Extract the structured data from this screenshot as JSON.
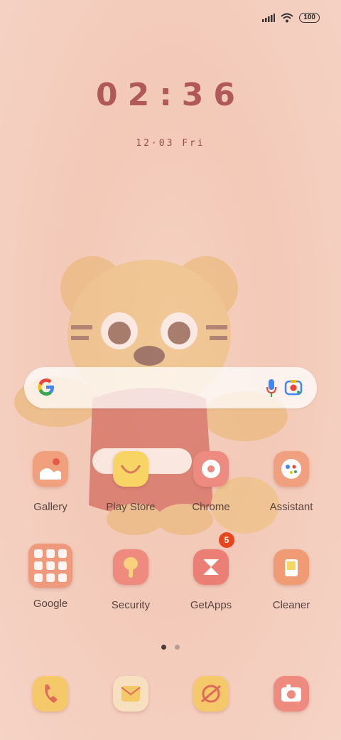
{
  "status": {
    "battery": "100"
  },
  "lockscreen": {
    "time": "02:36",
    "date": "12·03  Fri"
  },
  "apps_row1": [
    {
      "label": "Gallery"
    },
    {
      "label": "Play Store"
    },
    {
      "label": "Chrome"
    },
    {
      "label": "Assistant"
    }
  ],
  "apps_row2": [
    {
      "label": "Google"
    },
    {
      "label": "Security"
    },
    {
      "label": "GetApps",
      "badge": "5"
    },
    {
      "label": "Cleaner"
    }
  ],
  "page_indicator": {
    "pages": 2,
    "current": 1
  },
  "colors": {
    "accent": "#b1585a",
    "badge": "#e8451d"
  }
}
